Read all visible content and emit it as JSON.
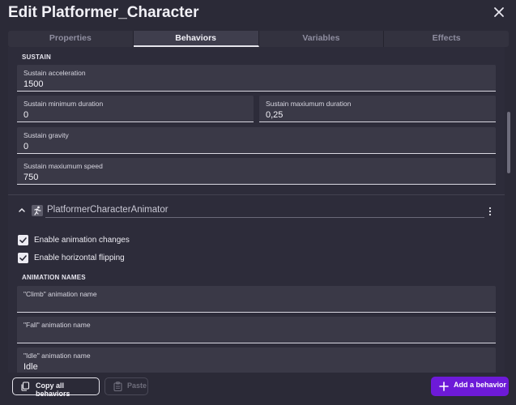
{
  "window": {
    "title": "Edit Platformer_Character"
  },
  "tabs": [
    {
      "label": "Properties"
    },
    {
      "label": "Behaviors"
    },
    {
      "label": "Variables"
    },
    {
      "label": "Effects"
    }
  ],
  "active_tab": "Behaviors",
  "sustain": {
    "section_label": "SUSTAIN",
    "acceleration": {
      "label": "Sustain acceleration",
      "value": "1500"
    },
    "min_duration": {
      "label": "Sustain minimum duration",
      "value": "0"
    },
    "max_duration": {
      "label": "Sustain maxiumum duration",
      "value": "0,25"
    },
    "gravity": {
      "label": "Sustain gravity",
      "value": "0"
    },
    "max_speed": {
      "label": "Sustain maxiumum speed",
      "value": "750"
    }
  },
  "behavior": {
    "name": "PlatformerCharacterAnimator",
    "options": [
      {
        "label": "Enable animation changes",
        "checked": true
      },
      {
        "label": "Enable horizontal flipping",
        "checked": true
      }
    ],
    "animation_section_label": "ANIMATION NAMES",
    "animation_fields": [
      {
        "label": "\"Climb\" animation name",
        "value": ""
      },
      {
        "label": "\"Fall\" animation name",
        "value": ""
      },
      {
        "label": "\"Idle\" animation name",
        "value": "Idle"
      }
    ]
  },
  "footer": {
    "copy_label": "Copy all behaviors",
    "paste_label": "Paste",
    "add_label": "Add a behavior"
  },
  "colors": {
    "background": "#2b2a37",
    "field": "#3a3947",
    "accent": "#6d1ad8"
  }
}
